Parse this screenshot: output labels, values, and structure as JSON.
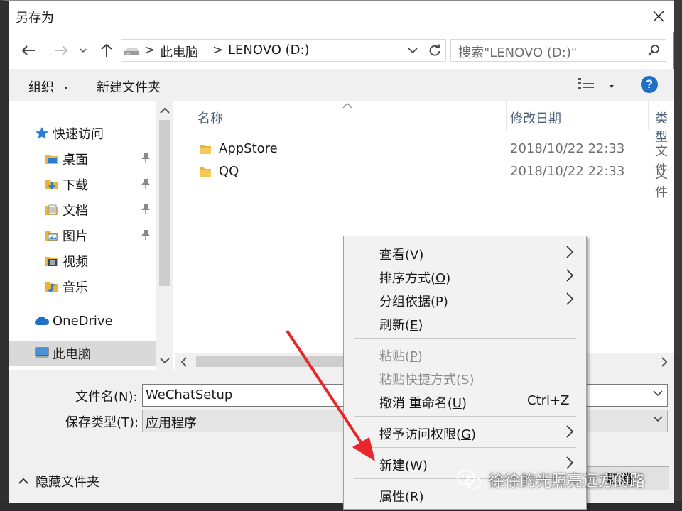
{
  "dialog": {
    "title": "另存为"
  },
  "nav": {
    "breadcrumb": [
      "此电脑",
      "LENOVO (D:)"
    ],
    "breadcrumb_separator": ">",
    "search_placeholder": "搜索\"LENOVO (D:)\""
  },
  "toolbar": {
    "organize_label": "组织",
    "new_folder_label": "新建文件夹",
    "help_label": "?"
  },
  "sidebar": {
    "quick_access": "快速访问",
    "items": [
      {
        "label": "桌面",
        "icon": "desktop-folder-icon",
        "pinned": true
      },
      {
        "label": "下载",
        "icon": "download-folder-icon",
        "pinned": true
      },
      {
        "label": "文档",
        "icon": "documents-folder-icon",
        "pinned": true
      },
      {
        "label": "图片",
        "icon": "pictures-folder-icon",
        "pinned": true
      },
      {
        "label": "视频",
        "icon": "videos-folder-icon",
        "pinned": false
      },
      {
        "label": "音乐",
        "icon": "music-folder-icon",
        "pinned": false
      }
    ],
    "onedrive": "OneDrive",
    "this_pc": "此电脑"
  },
  "file_list": {
    "columns": [
      "名称",
      "修改日期",
      "类型"
    ],
    "rows": [
      {
        "name": "AppStore",
        "modified": "2018/10/22 22:33",
        "type": "文件"
      },
      {
        "name": "QQ",
        "modified": "2018/10/22 22:33",
        "type": "文件"
      }
    ]
  },
  "form": {
    "filename_label": "文件名(N):",
    "filename_value": "WeChatSetup",
    "filetype_label": "保存类型(T):",
    "filetype_value": "应用程序",
    "hide_folders": "隐藏文件夹",
    "cancel_label": "取消"
  },
  "context_menu": {
    "items": [
      {
        "label": "查看",
        "key": "V",
        "submenu": true,
        "disabled": false
      },
      {
        "label": "排序方式",
        "key": "O",
        "submenu": true,
        "disabled": false
      },
      {
        "label": "分组依据",
        "key": "P",
        "submenu": true,
        "disabled": false
      },
      {
        "label": "刷新",
        "key": "E",
        "submenu": false,
        "disabled": false
      },
      {
        "label": "粘贴",
        "key": "P",
        "submenu": false,
        "disabled": true
      },
      {
        "label": "粘贴快捷方式",
        "key": "S",
        "submenu": false,
        "disabled": true
      },
      {
        "label": "撤消 重命名",
        "key": "U",
        "submenu": false,
        "disabled": false,
        "shortcut": "Ctrl+Z"
      },
      {
        "label": "授予访问权限",
        "key": "G",
        "submenu": true,
        "disabled": false
      },
      {
        "label": "新建",
        "key": "W",
        "submenu": true,
        "disabled": false
      },
      {
        "label": "属性",
        "key": "R",
        "submenu": false,
        "disabled": false
      }
    ]
  },
  "watermark": {
    "text": "徐徐的光照亮远方的路"
  },
  "colors": {
    "accent": "#1f6fc5",
    "annotation_arrow": "#e8262b",
    "folder": "#e8b43a"
  }
}
